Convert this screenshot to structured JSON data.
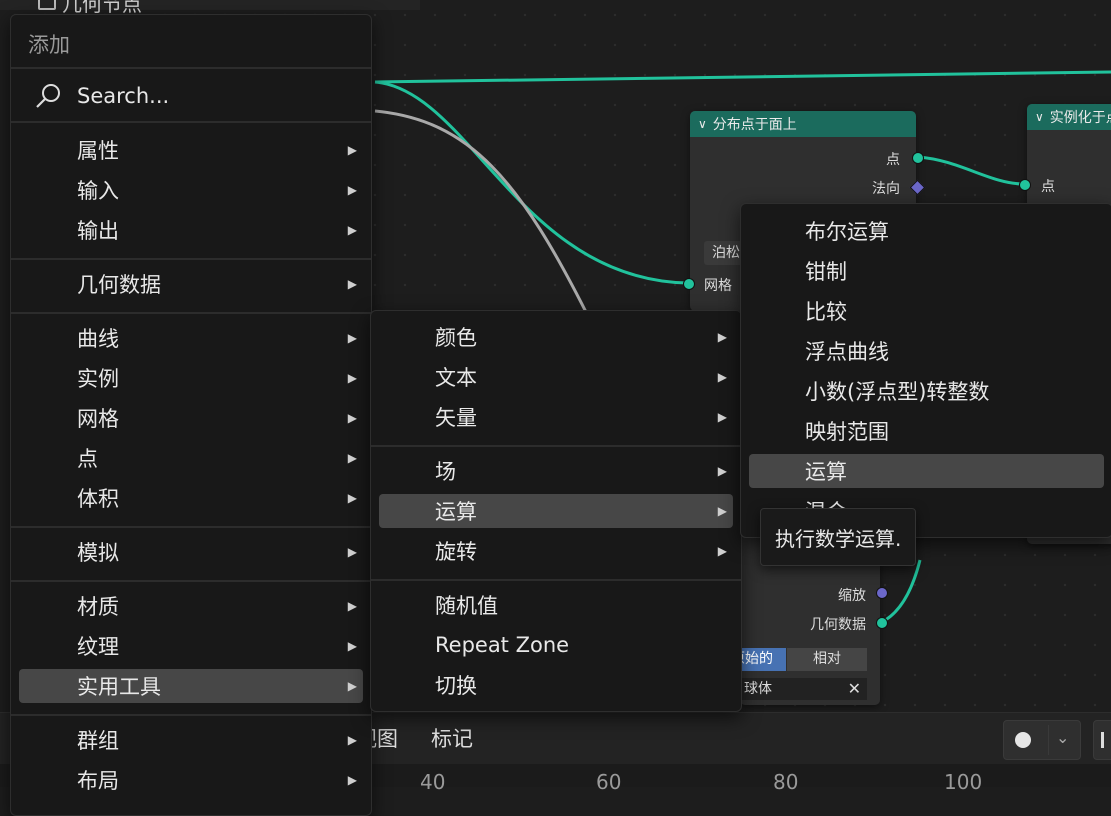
{
  "top_header": {
    "label": "几何节点"
  },
  "nodes": {
    "distribute": {
      "title": "分布点于面上",
      "outputs": [
        "点",
        "法向"
      ],
      "inputs": [
        "网格"
      ],
      "dropdown": "泊松"
    },
    "instance": {
      "title": "实例化于点上",
      "inputs": [
        "点"
      ]
    },
    "transform": {
      "rows": [
        "缩放",
        "几何数据"
      ],
      "toggle": [
        "原始的",
        "相对"
      ],
      "object_field": "球体"
    }
  },
  "add_menu": {
    "title": "添加",
    "search_placeholder": "Search...",
    "groups": [
      [
        "属性",
        "输入",
        "输出"
      ],
      [
        "几何数据"
      ],
      [
        "曲线",
        "实例",
        "网格",
        "点",
        "体积"
      ],
      [
        "模拟"
      ],
      [
        "材质",
        "纹理",
        "实用工具"
      ],
      [
        "群组",
        "布局"
      ]
    ],
    "active_item": "实用工具"
  },
  "utilities_menu": {
    "groups": [
      [
        "颜色",
        "文本",
        "矢量"
      ],
      [
        "场",
        "运算",
        "旋转"
      ],
      [
        "随机值",
        "Repeat Zone",
        "切换"
      ]
    ],
    "submenu_flags": [
      [
        true,
        true,
        true
      ],
      [
        true,
        true,
        true
      ],
      [
        false,
        false,
        false
      ]
    ],
    "active_item": "运算"
  },
  "math_menu": {
    "items": [
      "布尔运算",
      "钳制",
      "比较",
      "浮点曲线",
      "小数(浮点型)转整数",
      "映射范围",
      "运算",
      "混合"
    ],
    "active_item": "运算"
  },
  "tooltip": {
    "text": "执行数学运算."
  },
  "bottom_bar": {
    "menus": [
      "视图",
      "标记"
    ]
  },
  "timeline": {
    "ticks": [
      "40",
      "60",
      "80",
      "100"
    ]
  },
  "colors": {
    "geometry_socket": "#21c29c",
    "vector_socket": "#6b67c9",
    "node_header": "#1b6b5d",
    "menu_bg": "#181818",
    "highlight": "#474747"
  }
}
